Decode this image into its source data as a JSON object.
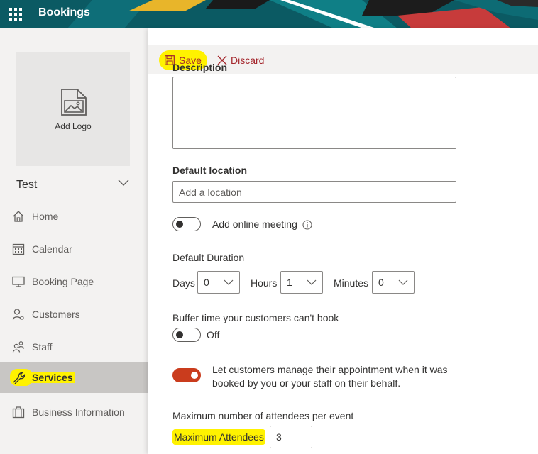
{
  "app": {
    "title": "Bookings"
  },
  "sidebar": {
    "logo_label": "Add Logo",
    "business_name": "Test",
    "items": [
      {
        "label": "Home",
        "icon": "home-icon"
      },
      {
        "label": "Calendar",
        "icon": "calendar-icon"
      },
      {
        "label": "Booking Page",
        "icon": "monitor-icon"
      },
      {
        "label": "Customers",
        "icon": "customers-icon"
      },
      {
        "label": "Staff",
        "icon": "staff-icon"
      },
      {
        "label": "Services",
        "icon": "wrench-icon",
        "active": true
      },
      {
        "label": "Business Information",
        "icon": "briefcase-icon"
      }
    ]
  },
  "toolbar": {
    "save_label": "Save",
    "discard_label": "Discard"
  },
  "form": {
    "description_label": "Description",
    "description_value": "",
    "location_label": "Default location",
    "location_placeholder": "Add a location",
    "online_meeting_label": "Add online meeting",
    "duration_label": "Default Duration",
    "days_label": "Days",
    "days_value": "0",
    "hours_label": "Hours",
    "hours_value": "1",
    "minutes_label": "Minutes",
    "minutes_value": "0",
    "buffer_label": "Buffer time your customers can't book",
    "buffer_state": "Off",
    "manage_label_line1": "Let customers manage their appointment when it was",
    "manage_label_line2": "booked by you or your staff on their behalf.",
    "max_attendees_heading": "Maximum number of attendees per event",
    "max_attendees_label": "Maximum Attendees",
    "max_attendees_value": "3"
  },
  "colors": {
    "topbar": "#0b5a63",
    "accent": "#ca3c1d",
    "highlight": "#fff200",
    "command": "#a4262c"
  }
}
